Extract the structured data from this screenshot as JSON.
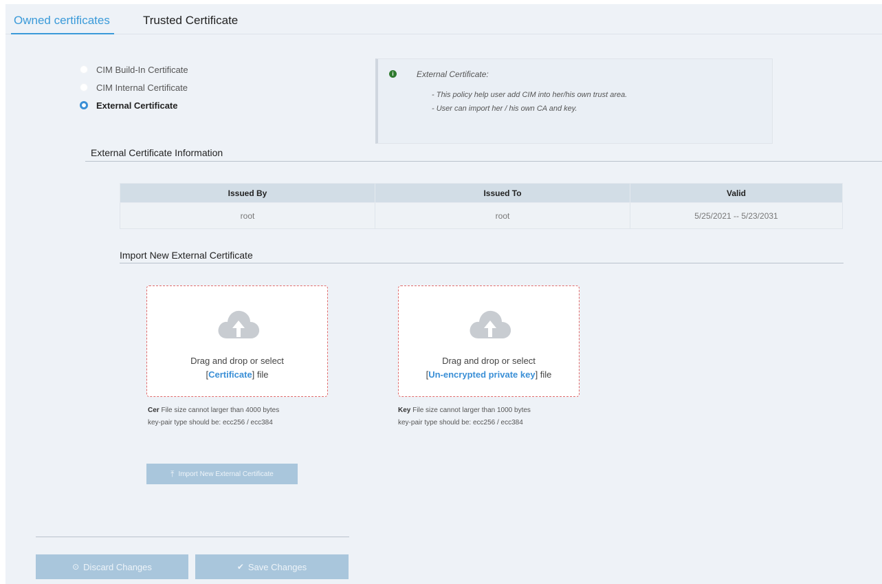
{
  "tabs": [
    {
      "label": "Owned certificates",
      "active": true
    },
    {
      "label": "Trusted Certificate",
      "active": false
    }
  ],
  "radio_options": [
    {
      "label": "CIM Build-In Certificate",
      "checked": false
    },
    {
      "label": "CIM Internal Certificate",
      "checked": false
    },
    {
      "label": "External Certificate",
      "checked": true
    }
  ],
  "info": {
    "icon": "info-icon",
    "title": "External Certificate:",
    "lines": [
      "- This policy help user add CIM into her/his own trust area.",
      "- User can import her / his own CA and key."
    ]
  },
  "external_info": {
    "title": "External Certificate Information",
    "columns": [
      "Issued By",
      "Issued To",
      "Valid"
    ],
    "rows": [
      [
        "root",
        "root",
        "5/25/2021 -- 5/23/2031"
      ]
    ]
  },
  "import": {
    "title": "Import New External Certificate",
    "cert_zone": {
      "line1": "Drag and drop or select",
      "bracket_open": "[",
      "link": "Certificate",
      "suffix": "] file",
      "hint_bold": "Cer",
      "hint_line1": " File size cannot larger than 4000 bytes",
      "hint_line2": "key-pair type should be: ecc256 / ecc384"
    },
    "key_zone": {
      "line1": "Drag and drop or select",
      "bracket_open": "[",
      "link": "Un-encrypted private key",
      "suffix": "] file",
      "hint_bold": "Key",
      "hint_line1": " File size cannot larger than 1000 bytes",
      "hint_line2": "key-pair type should be: ecc256 / ecc384"
    },
    "button_label": "Import New External Certificate",
    "button_icon": "upload-icon"
  },
  "footer": {
    "discard_label": "Discard Changes",
    "discard_icon": "discard-circle-icon",
    "save_label": "Save Changes",
    "save_icon": "check-circle-icon"
  },
  "colors": {
    "accent": "#3a9ad9",
    "button_disabled": "#a9c6dc",
    "dropzone_border": "#e06a6a",
    "info_icon": "#2f7a2f"
  }
}
